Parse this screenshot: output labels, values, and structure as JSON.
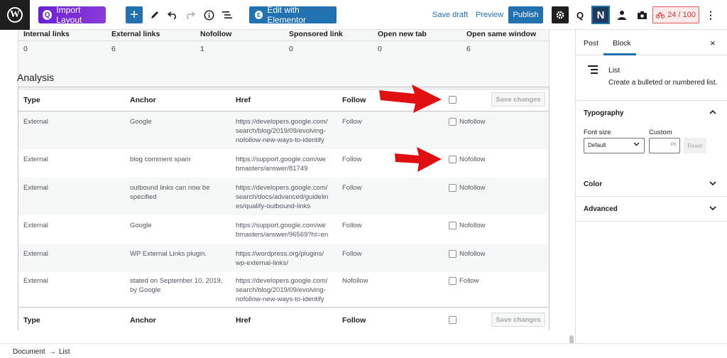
{
  "toolbar": {
    "wp_logo": "W",
    "import_layout": "Import Layout",
    "import_icon": "Q",
    "add_block": "+",
    "edit_elementor": "Edit with Elementor",
    "elementor_icon": "E",
    "save_draft": "Save draft",
    "preview": "Preview",
    "publish": "Publish",
    "quick_icon": "Q",
    "n_icon": "N",
    "score": "24 / 100",
    "more": "⋮",
    "icons": [
      "pencil-icon",
      "undo-icon",
      "redo-icon",
      "info-icon",
      "list-view-icon",
      "settings-icon",
      "rank-math-icon",
      "person-icon",
      "camera-icon"
    ]
  },
  "stats": {
    "headers": [
      "Internal links",
      "External links",
      "Nofollow",
      "Sponsored link",
      "Open new tab",
      "Open same window"
    ],
    "values": [
      "0",
      "6",
      "1",
      "0",
      "0",
      "6"
    ]
  },
  "analysis": {
    "title": "Analysis",
    "headers": [
      "Type",
      "Anchor",
      "Href",
      "Follow"
    ],
    "save_changes": "Save changes",
    "rows": [
      {
        "type": "External",
        "anchor": "Google",
        "href": "https://developers.google.com/\nsearch/blog/2019/09/evolving-\nnofollow-new-ways-to-identify",
        "follow": "Follow",
        "option": "Nofollow"
      },
      {
        "type": "External",
        "anchor": "blog comment spam",
        "href": "https://support.google.com/we\nbmasters/answer/81749",
        "follow": "Follow",
        "option": "Nofollow"
      },
      {
        "type": "External",
        "anchor": "outbound links can now be\nspecified",
        "href": "https://developers.google.com/\nsearch/docs/advanced/guidelin\nes/qualify-outbound-links",
        "follow": "Follow",
        "option": "Nofollow"
      },
      {
        "type": "External",
        "anchor": "Google",
        "href": "https://support.google.com/we\nbmasters/answer/96569?hl=en",
        "follow": "Follow",
        "option": "Nofollow"
      },
      {
        "type": "External",
        "anchor": "WP External Links plugin.",
        "href": "https://wordpress.org/plugins/\nwp-external-links/",
        "follow": "Follow",
        "option": "Nofollow"
      },
      {
        "type": "External",
        "anchor": "stated on September 10, 2019,\nby Google",
        "href": "https://developers.google.com/\nsearch/blog/2019/09/evolving-\nnofollow-new-ways-to-identify",
        "follow": "Nofollow",
        "option": "Follow"
      }
    ]
  },
  "sidebar": {
    "tabs": [
      "Post",
      "Block"
    ],
    "close": "×",
    "block_name": "List",
    "block_desc": "Create a bulleted or numbered list.",
    "typography": "Typography",
    "font_size": "Font size",
    "custom": "Custom",
    "font_size_value": "Default",
    "px": "PX",
    "reset": "Reset",
    "color": "Color",
    "advanced": "Advanced"
  },
  "breadcrumb": {
    "document": "Document",
    "separator": "→",
    "list": "List"
  },
  "colors": {
    "accent": "#2271b1",
    "import_purple": "#7b2bd8",
    "arrow_red": "#e01010",
    "score_red": "#d63638"
  }
}
